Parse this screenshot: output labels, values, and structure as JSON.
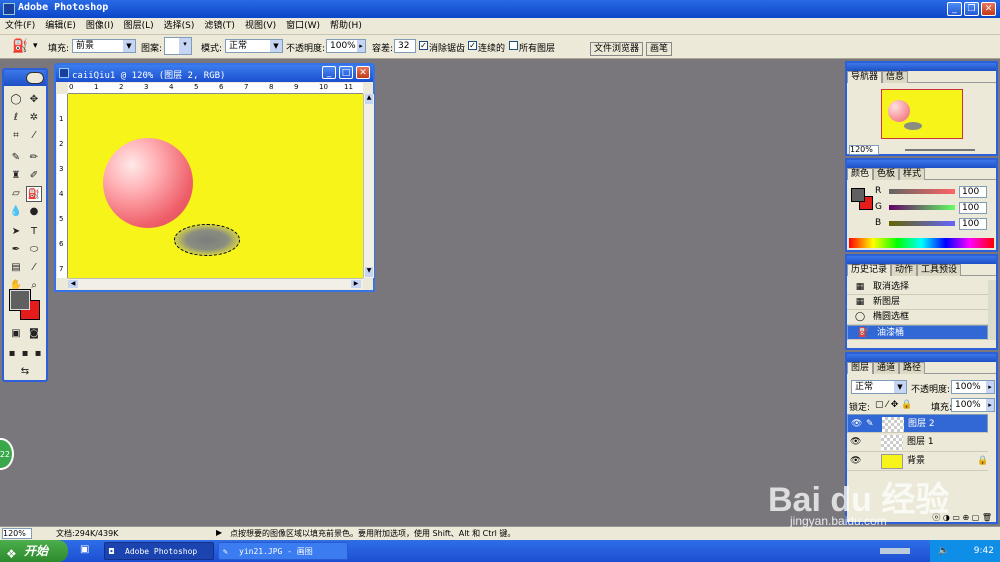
{
  "titlebar": {
    "title": "Adobe Photoshop",
    "minimize": "_",
    "restore": "❐",
    "close": "✕"
  },
  "menu": [
    "文件(F)",
    "编辑(E)",
    "图像(I)",
    "图层(L)",
    "选择(S)",
    "滤镜(T)",
    "视图(V)",
    "窗口(W)",
    "帮助(H)"
  ],
  "options": {
    "fill_label": "填充:",
    "fill_value": "前景",
    "pattern_label": "图案:",
    "mode_label": "模式:",
    "mode_value": "正常",
    "opacity_label": "不透明度:",
    "opacity_value": "100%",
    "tolerance_label": "容差:",
    "tolerance_value": "32",
    "antialias_label": "消除锯齿",
    "contiguous_label": "连续的",
    "all_layers_label": "所有图层",
    "file_browser_tab": "文件浏览器",
    "brushes_tab": "画笔"
  },
  "document": {
    "title": "caiiQiu1 @ 120% (图层 2, RGB)",
    "ruler_h": [
      "0",
      "1",
      "2",
      "3",
      "4",
      "5",
      "6",
      "7",
      "8",
      "9",
      "10",
      "11"
    ],
    "ruler_v": [
      "1",
      "2",
      "3",
      "4",
      "5",
      "6",
      "7"
    ]
  },
  "navigator": {
    "tabs": [
      "导航器",
      "信息"
    ],
    "zoom": "120%"
  },
  "color_panel": {
    "tabs": [
      "颜色",
      "色板",
      "样式"
    ],
    "channels": [
      {
        "label": "R",
        "value": "100"
      },
      {
        "label": "G",
        "value": "100"
      },
      {
        "label": "B",
        "value": "100"
      }
    ]
  },
  "history": {
    "tabs": [
      "历史记录",
      "动作",
      "工具预设"
    ],
    "items": [
      "取消选择",
      "新图层",
      "椭圆选框",
      "油漆桶"
    ]
  },
  "layers": {
    "tabs": [
      "图层",
      "通道",
      "路径"
    ],
    "blend_mode": "正常",
    "opacity_label": "不透明度:",
    "opacity_value": "100%",
    "lock_label": "锁定:",
    "fill_label": "填充:",
    "fill_value": "100%",
    "items": [
      "图层 2",
      "图层 1",
      "背景"
    ]
  },
  "status": {
    "zoom": "120%",
    "doc_size": "文档:294K/439K",
    "hint": "点按想要的图像区域以填充前景色。要用附加选项，使用 Shift、Alt 和 Ctrl 键。"
  },
  "taskbar": {
    "start": "开始",
    "tasks": [
      "Adobe Photoshop",
      "yin21.JPG - 画图"
    ],
    "clock": "9:42"
  },
  "watermark": {
    "brand": "Bai du 经验",
    "url": "jingyan.baidu.com"
  },
  "colors": {
    "canvas_yellow": "#f7f41a",
    "xp_blue": "#1d4fc5",
    "selection_blue": "#3168d5"
  }
}
